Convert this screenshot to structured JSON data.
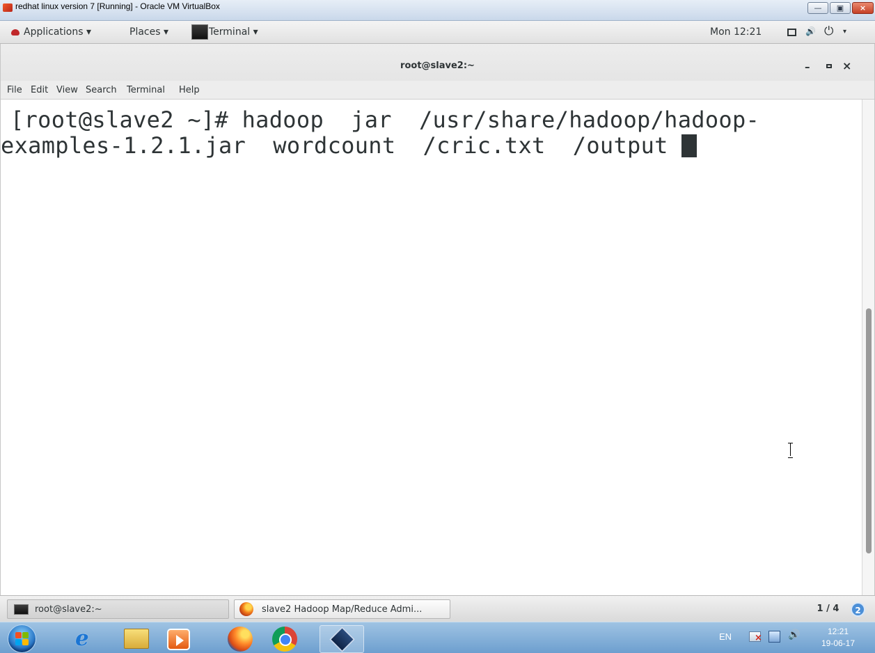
{
  "host_window": {
    "title": "redhat linux version 7 [Running] - Oracle VM VirtualBox",
    "minimize_label": "—",
    "maximize_label": "▣",
    "close_label": "×"
  },
  "gnome_top_bar": {
    "applications": "Applications ▾",
    "places": "Places ▾",
    "active_app": "Terminal ▾",
    "clock": "Mon 12:21",
    "volume_glyph": "🔊",
    "power_glyph": "⏻",
    "menu_arrow": "▾"
  },
  "terminal_window": {
    "title": "root@slave2:~",
    "minimize_glyph": "–",
    "close_glyph": "×",
    "menu": [
      "File",
      "Edit",
      "View",
      "Search",
      "Terminal",
      "Help"
    ],
    "lines": [
      "[root@slave2 ~]# hadoop  jar  /usr/share/hadoop/hadoop-",
      "examples-1.2.1.jar  wordcount  /cric.txt  /output "
    ]
  },
  "gnome_taskbar": {
    "items": [
      {
        "label": "root@slave2:~",
        "icon": "terminal-icon",
        "active": true
      },
      {
        "label": "slave2 Hadoop Map/Reduce Admi...",
        "icon": "firefox-icon",
        "active": false
      }
    ],
    "workspace": "1 / 4",
    "notifications": "2"
  },
  "windows_taskbar": {
    "pinned_icons": [
      "internet-explorer-icon",
      "windows-explorer-icon",
      "media-player-icon",
      "firefox-icon",
      "chrome-icon",
      "virtualbox-icon"
    ],
    "ie_glyph": "e",
    "language": "EN",
    "volume_glyph": "🔊",
    "time": "12:21",
    "date": "19-06-17"
  }
}
